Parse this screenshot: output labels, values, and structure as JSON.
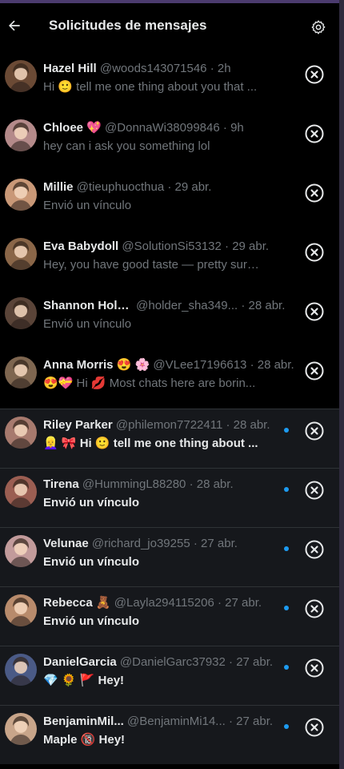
{
  "header": {
    "title": "Solicitudes de mensajes"
  },
  "colors": {
    "accent": "#1d9bf0",
    "text": "#e7e9ea",
    "muted": "#71767b",
    "unread_bg": "#16181c"
  },
  "requests": [
    {
      "name": "Hazel Hill",
      "name_emoji": "",
      "handle": "@woods143071546",
      "time": "2h",
      "preview": "Hi 🙂 tell me one thing about you that ...",
      "unread": false,
      "avatar_color": "#6b4a35"
    },
    {
      "name": "Chloee",
      "name_emoji": "💖",
      "handle": "@DonnaWi38099846",
      "time": "9h",
      "preview": "hey can i ask you something lol",
      "unread": false,
      "avatar_color": "#b48a8a"
    },
    {
      "name": "Millie",
      "name_emoji": "",
      "handle": "@tieuphuocthua",
      "time": "29 abr.",
      "preview": "Envió un vínculo",
      "unread": false,
      "avatar_color": "#c99877"
    },
    {
      "name": "Eva Babydoll",
      "name_emoji": "",
      "handle": "@SolutionSi53132",
      "time": "29 abr.",
      "preview": "Hey, you have good taste — pretty sure ...",
      "unread": false,
      "avatar_color": "#8a6648"
    },
    {
      "name": "Shannon Hold...",
      "name_emoji": "",
      "handle": "@holder_sha349...",
      "time": "28 abr.",
      "preview": "Envió un vínculo",
      "unread": false,
      "avatar_color": "#5a4438"
    },
    {
      "name": "Anna Morris",
      "name_emoji": "😍 🌸",
      "handle": "@VLee17196613",
      "time": "28 abr.",
      "preview": "😍💝 Hi 💋 Most chats here are borin...",
      "unread": false,
      "avatar_color": "#7e6650"
    },
    {
      "name": "Riley Parker",
      "name_emoji": "",
      "handle": "@philemon7722411",
      "time": "28 abr.",
      "preview": "👱‍♀️ 🎀 Hi 🙂 tell me one thing about ...",
      "unread": true,
      "avatar_color": "#a77a6e"
    },
    {
      "name": "Tirena",
      "name_emoji": "",
      "handle": "@HummingL88280",
      "time": "28 abr.",
      "preview": "Envió un vínculo",
      "unread": true,
      "avatar_color": "#9b5e52"
    },
    {
      "name": "Velunae",
      "name_emoji": "",
      "handle": "@richard_jo39255",
      "time": "27 abr.",
      "preview": "Envió un vínculo",
      "unread": true,
      "avatar_color": "#c29b9b"
    },
    {
      "name": "Rebecca",
      "name_emoji": "🧸",
      "handle": "@Layla294115206",
      "time": "27 abr.",
      "preview": "Envió un vínculo",
      "unread": true,
      "avatar_color": "#b88b6c"
    },
    {
      "name": "DanielGarcia",
      "name_emoji": "",
      "handle": "@DanielGarc37932",
      "time": "27 abr.",
      "preview": "💎 🌻 🚩 Hey!",
      "unread": true,
      "avatar_color": "#4a5a86"
    },
    {
      "name": "BenjaminMil...",
      "name_emoji": "",
      "handle": "@BenjaminMi14...",
      "time": "27 abr.",
      "preview": "Maple 🔞 Hey!",
      "unread": true,
      "avatar_color": "#c8a58a"
    }
  ]
}
